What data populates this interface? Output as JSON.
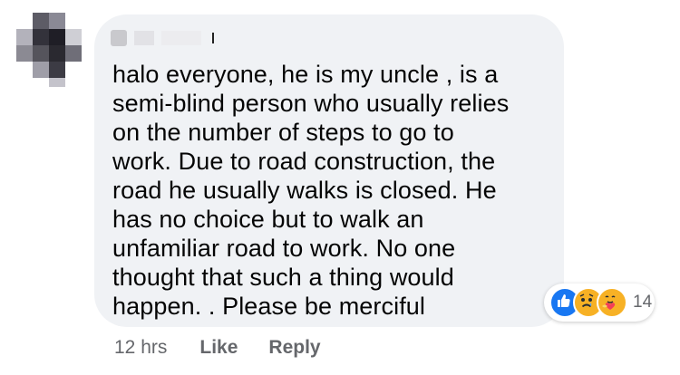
{
  "comment": {
    "lines": [
      "halo everyone, he is my uncle ,  is a",
      "semi-blind person who usually relies",
      "on the number of steps to go to",
      "work. Due to road construction, the",
      "road he usually walks is closed. He",
      "has no choice but to walk an",
      "unfamiliar road to work. No one",
      "thought that such a thing would",
      "happen. . Please be merciful"
    ]
  },
  "reactions": {
    "icons": [
      "like-icon",
      "sad-icon",
      "care-icon"
    ],
    "count": "14"
  },
  "actions": {
    "timestamp": "12 hrs",
    "like_label": "Like",
    "reply_label": "Reply"
  },
  "colors": {
    "bubble": "#f0f2f5",
    "text": "#050505",
    "muted": "#65676b",
    "like_blue": "#1877f2",
    "emoji_yellow": "#f7b125"
  }
}
